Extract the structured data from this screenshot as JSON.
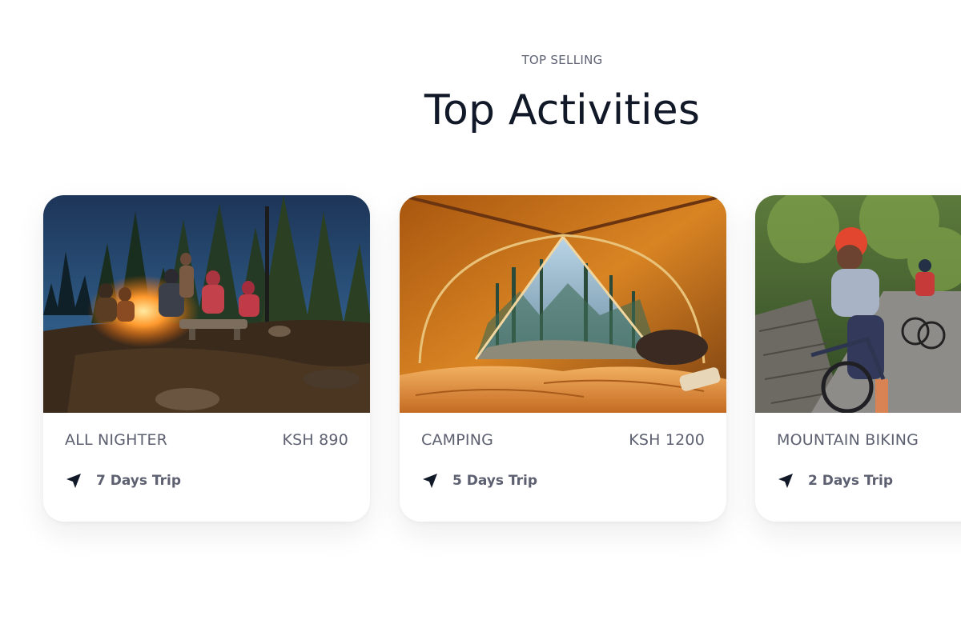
{
  "header": {
    "eyebrow": "TOP SELLING",
    "title": "Top Activities"
  },
  "colors": {
    "title": "#111827",
    "muted_text": "#5c6070",
    "background": "#ffffff"
  },
  "activities": [
    {
      "name": "ALL NIGHTER",
      "price": "KSH 890",
      "trip_icon": "navigation-arrow-icon",
      "trip": "7 Days Trip",
      "image": "campfire-night-photo"
    },
    {
      "name": "CAMPING",
      "price": "KSH 1200",
      "trip_icon": "navigation-arrow-icon",
      "trip": "5 Days Trip",
      "image": "tent-forest-view-photo"
    },
    {
      "name": "MOUNTAIN BIKING",
      "price": "",
      "trip_icon": "navigation-arrow-icon",
      "trip": "2 Days Trip",
      "image": "cyclists-forest-road-photo"
    }
  ]
}
